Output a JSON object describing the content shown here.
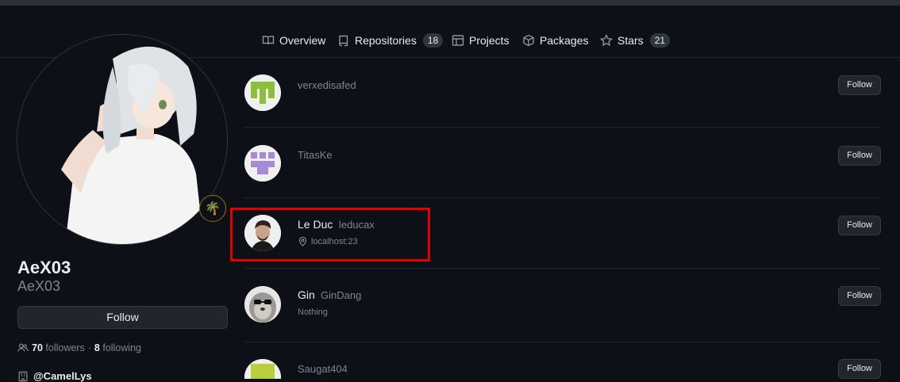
{
  "tabs": [
    {
      "label": "Overview",
      "icon": "book-icon"
    },
    {
      "label": "Repositories",
      "icon": "repo-icon",
      "count": "18"
    },
    {
      "label": "Projects",
      "icon": "table-icon"
    },
    {
      "label": "Packages",
      "icon": "package-icon"
    },
    {
      "label": "Stars",
      "icon": "star-icon",
      "count": "21"
    }
  ],
  "profile": {
    "name": "AeX03",
    "login": "AeX03",
    "status_emoji": "🌴",
    "follow_label": "Follow",
    "followers_count": "70",
    "followers_label": "followers",
    "separator": "·",
    "following_count": "8",
    "following_label": "following",
    "org": "@CamelLys"
  },
  "followers": [
    {
      "name": "",
      "login": "verxedisafed",
      "meta": "",
      "follow_label": "Follow",
      "avatar": "identicon-green"
    },
    {
      "name": "",
      "login": "TitasKe",
      "meta": "",
      "follow_label": "Follow",
      "avatar": "identicon-purple"
    },
    {
      "name": "Le Duc",
      "login": "leducax",
      "meta": "localhost:23",
      "follow_label": "Follow",
      "avatar": "photo-man"
    },
    {
      "name": "Gin",
      "login": "GinDang",
      "meta": "Nothing",
      "follow_label": "Follow",
      "avatar": "sloth-sunglasses"
    },
    {
      "name": "",
      "login": "Saugat404",
      "meta": "",
      "follow_label": "Follow",
      "avatar": "identicon-lime"
    }
  ],
  "colors": {
    "background": "#0d1117",
    "highlight_box": "#e00000",
    "muted_text": "#7d8590"
  }
}
